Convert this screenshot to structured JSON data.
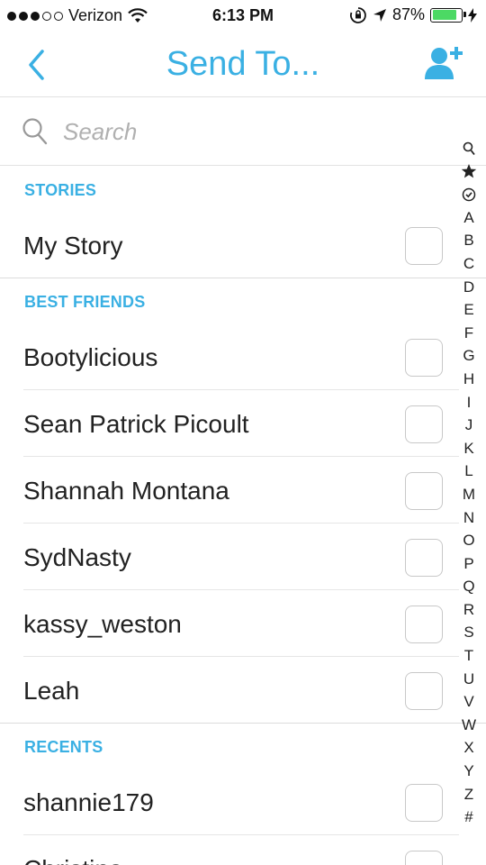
{
  "status_bar": {
    "carrier": "Verizon",
    "time": "6:13 PM",
    "battery_percent": "87%",
    "battery_level": 0.87,
    "icons": [
      "signal-dots-icon",
      "wifi-icon",
      "rotation-lock-icon",
      "location-arrow-icon",
      "battery-icon",
      "charging-bolt-icon"
    ]
  },
  "nav": {
    "title": "Send To...",
    "back_icon": "chevron-left-icon",
    "add_friend_icon": "add-friend-icon"
  },
  "search": {
    "placeholder": "Search",
    "value": ""
  },
  "sections": [
    {
      "header": "STORIES",
      "items": [
        {
          "name": "My Story",
          "checked": false
        }
      ]
    },
    {
      "header": "BEST FRIENDS",
      "items": [
        {
          "name": "Bootylicious",
          "checked": false
        },
        {
          "name": "Sean Patrick Picoult",
          "checked": false
        },
        {
          "name": "Shannah Montana",
          "checked": false
        },
        {
          "name": "SydNasty",
          "checked": false
        },
        {
          "name": "kassy_weston",
          "checked": false
        },
        {
          "name": "Leah",
          "checked": false
        }
      ]
    },
    {
      "header": "RECENTS",
      "items": [
        {
          "name": "shannie179",
          "checked": false
        },
        {
          "name": "Christina",
          "checked": false
        }
      ]
    }
  ],
  "index_bar": [
    "A",
    "B",
    "C",
    "D",
    "E",
    "F",
    "G",
    "H",
    "I",
    "J",
    "K",
    "L",
    "M",
    "N",
    "O",
    "P",
    "Q",
    "R",
    "S",
    "T",
    "U",
    "V",
    "W",
    "X",
    "Y",
    "Z",
    "#"
  ],
  "colors": {
    "accent": "#3ab0e3",
    "battery_green": "#4cd964",
    "text": "#222222",
    "divider": "#e2e2e2"
  }
}
